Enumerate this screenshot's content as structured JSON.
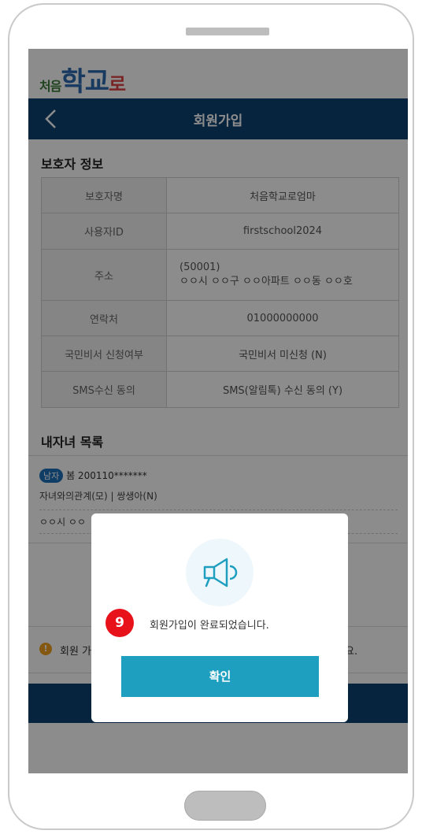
{
  "app": {
    "logo_small": "처음",
    "logo_big": "학교",
    "logo_end": "로"
  },
  "header": {
    "title": "회원가입"
  },
  "guardian": {
    "section_title": "보호자 정보",
    "rows": [
      {
        "label": "보호자명",
        "value": "처음학교로엄마"
      },
      {
        "label": "사용자ID",
        "value": "firstschool2024"
      },
      {
        "label": "주소",
        "value_line1": "(50001)",
        "value_line2": "ㅇㅇ시 ㅇㅇ구 ㅇㅇ아파트 ㅇㅇ동 ㅇㅇ호"
      },
      {
        "label": "연락처",
        "value": "01000000000"
      },
      {
        "label": "국민비서 신청여부",
        "value": "국민비서 미신청 (N)"
      },
      {
        "label": "SMS수신 동의",
        "value": "SMS(알림톡) 수신 동의 (Y)"
      }
    ]
  },
  "children": {
    "section_title": "내자녀 목록",
    "item": {
      "gender_badge": "남자",
      "name_birth": "봄 200110*******",
      "relation": "자녀와의관계(모) | 쌍생아(N)",
      "address": "ㅇㅇ시 ㅇㅇ"
    }
  },
  "notice": {
    "text_left": "회원 가",
    "text_right": "요."
  },
  "modal": {
    "step_number": "9",
    "message": "회원가입이 완료되었습니다.",
    "confirm_label": "확인",
    "icon": "megaphone-icon"
  },
  "colors": {
    "header": "#0d4273",
    "confirm": "#1f9fc0",
    "step_badge": "#e8121b"
  }
}
